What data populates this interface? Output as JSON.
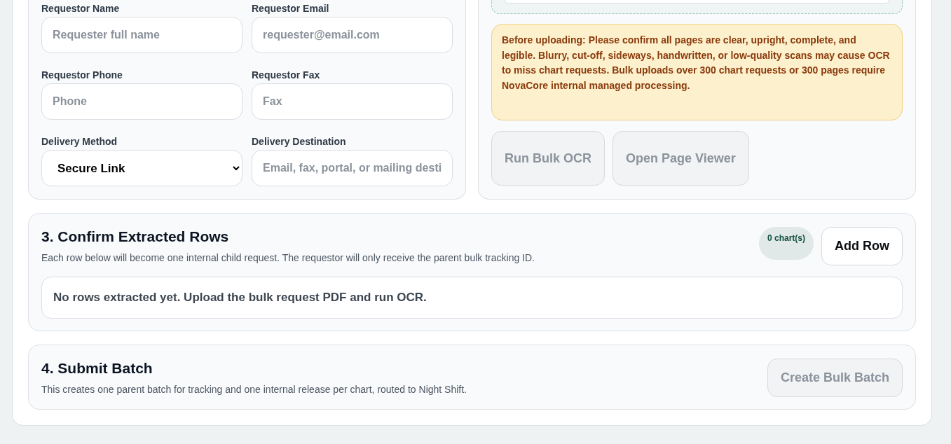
{
  "requestor_form": {
    "fields": [
      {
        "label": "Requestor Name",
        "kind": "text",
        "placeholder": "Requester full name"
      },
      {
        "label": "Requestor Email",
        "kind": "text",
        "placeholder": "requester@email.com"
      },
      {
        "label": "Requestor Phone",
        "kind": "text",
        "placeholder": "Phone"
      },
      {
        "label": "Requestor Fax",
        "kind": "text",
        "placeholder": "Fax"
      },
      {
        "label": "Delivery Method",
        "kind": "select",
        "value": "Secure Link"
      },
      {
        "label": "Delivery Destination",
        "kind": "text",
        "placeholder": "Email, fax, portal, or mailing desti"
      }
    ]
  },
  "upload": {
    "warning": "Before uploading: Please confirm all pages are clear, upright, complete, and legible. Blurry, cut-off, sideways, handwritten, or low-quality scans may cause OCR to miss chart requests. Bulk uploads over 300 chart requests or 300 pages require NovaCore internal managed processing.",
    "buttons": [
      {
        "label": "Run Bulk OCR",
        "disabled": true
      },
      {
        "label": "Open Page Viewer",
        "disabled": true
      }
    ]
  },
  "confirm_rows": {
    "title": "3. Confirm Extracted Rows",
    "description": "Each row below will become one internal child request. The requestor will only receive the parent bulk tracking ID.",
    "count_badge": "0 chart(s)",
    "button": {
      "label": "Add Row",
      "disabled": false
    },
    "empty_message": "No rows extracted yet. Upload the bulk request PDF and run OCR."
  },
  "submit_batch": {
    "title": "4. Submit Batch",
    "description": "This creates one parent batch for tracking and one internal release per chart, routed to Night Shift.",
    "button": {
      "label": "Create Bulk Batch",
      "disabled": true
    }
  }
}
